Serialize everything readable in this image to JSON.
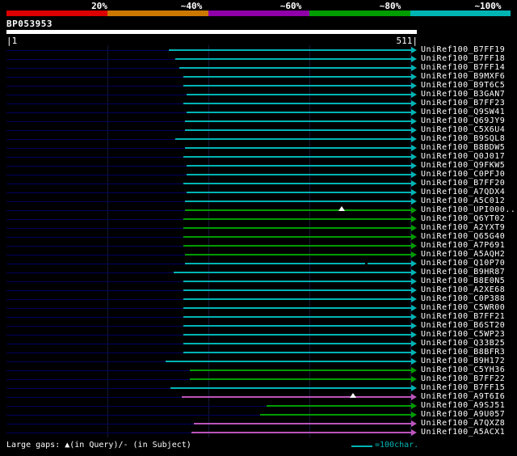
{
  "header": {
    "query_id": "BP053953",
    "coord_left": "|1",
    "coord_right": "511|",
    "scale": {
      "labels": [
        "20%",
        "~40%",
        "~60%",
        "~80%",
        "~100%"
      ],
      "colors": [
        "#dd0000",
        "#cc7700",
        "#9000a8",
        "#009c00",
        "#00b4b4"
      ]
    }
  },
  "footer": {
    "gaps_note": "Large gaps: ▲(in Query)/- (in Subject)",
    "unit_legend": "=100char.",
    "unit_legend_color": "#00b4b4"
  },
  "chart_data": {
    "type": "bar",
    "title": "BP053953",
    "xlim": [
      1,
      511
    ],
    "identity_classes": {
      "cyan": "~100%",
      "green": "~80%",
      "magenta": "~60%"
    },
    "bar_colors": {
      "cyan": "#00b4b4",
      "green": "#009c00",
      "magenta": "#bb55bb"
    },
    "rows": [
      {
        "label": "UniRef100_B7FF19",
        "start": 203,
        "end": 511,
        "identity": "cyan"
      },
      {
        "label": "UniRef100_B7FF18",
        "start": 211,
        "end": 511,
        "identity": "cyan"
      },
      {
        "label": "UniRef100_B7FF14",
        "start": 216,
        "end": 511,
        "identity": "cyan"
      },
      {
        "label": "UniRef100_B9MXF6",
        "start": 221,
        "end": 511,
        "identity": "cyan"
      },
      {
        "label": "UniRef100_B9T6C5",
        "start": 221,
        "end": 511,
        "identity": "cyan"
      },
      {
        "label": "UniRef100_B3GAN7",
        "start": 225,
        "end": 511,
        "identity": "cyan"
      },
      {
        "label": "UniRef100_B7FF23",
        "start": 221,
        "end": 511,
        "identity": "cyan"
      },
      {
        "label": "UniRef100_Q9SW41",
        "start": 225,
        "end": 511,
        "identity": "cyan"
      },
      {
        "label": "UniRef100_Q69JY9",
        "start": 223,
        "end": 511,
        "identity": "cyan"
      },
      {
        "label": "UniRef100_C5X6U4",
        "start": 223,
        "end": 511,
        "identity": "cyan"
      },
      {
        "label": "UniRef100_B9SQL8",
        "start": 211,
        "end": 511,
        "identity": "cyan"
      },
      {
        "label": "UniRef100_B8BDW5",
        "start": 223,
        "end": 511,
        "identity": "cyan"
      },
      {
        "label": "UniRef100_Q0J017",
        "start": 221,
        "end": 511,
        "identity": "cyan"
      },
      {
        "label": "UniRef100_Q9FKW5",
        "start": 225,
        "end": 511,
        "identity": "cyan"
      },
      {
        "label": "UniRef100_C0PFJ0",
        "start": 225,
        "end": 511,
        "identity": "cyan"
      },
      {
        "label": "UniRef100_B7FF20",
        "start": 221,
        "end": 511,
        "identity": "cyan"
      },
      {
        "label": "UniRef100_A7QDX4",
        "start": 225,
        "end": 511,
        "identity": "cyan"
      },
      {
        "label": "UniRef100_A5C012",
        "start": 223,
        "end": 511,
        "identity": "cyan"
      },
      {
        "label": "UniRef100_UPI000...",
        "start": 223,
        "end": 511,
        "identity": "green",
        "markers": [
          {
            "type": "query_gap",
            "pos": 418
          }
        ]
      },
      {
        "label": "UniRef100_Q6YT02",
        "start": 221,
        "end": 511,
        "identity": "green"
      },
      {
        "label": "UniRef100_A2YXT9",
        "start": 221,
        "end": 511,
        "identity": "green"
      },
      {
        "label": "UniRef100_Q65G40",
        "start": 221,
        "end": 511,
        "identity": "green"
      },
      {
        "label": "UniRef100_A7P691",
        "start": 221,
        "end": 511,
        "identity": "green"
      },
      {
        "label": "UniRef100_A5AQH2",
        "start": 223,
        "end": 511,
        "identity": "green"
      },
      {
        "label": "UniRef100_Q10P70",
        "start": 223,
        "end": 511,
        "identity": "cyan",
        "markers": [
          {
            "type": "subject_gap",
            "pos": 448
          }
        ]
      },
      {
        "label": "UniRef100_B9HR87",
        "start": 209,
        "end": 511,
        "identity": "cyan"
      },
      {
        "label": "UniRef100_B8E0N5",
        "start": 221,
        "end": 511,
        "identity": "cyan"
      },
      {
        "label": "UniRef100_A2XE68",
        "start": 221,
        "end": 511,
        "identity": "cyan"
      },
      {
        "label": "UniRef100_C0P388",
        "start": 221,
        "end": 511,
        "identity": "cyan"
      },
      {
        "label": "UniRef100_C5WR00",
        "start": 221,
        "end": 511,
        "identity": "cyan"
      },
      {
        "label": "UniRef100_B7FF21",
        "start": 221,
        "end": 511,
        "identity": "cyan"
      },
      {
        "label": "UniRef100_B6ST20",
        "start": 221,
        "end": 511,
        "identity": "cyan"
      },
      {
        "label": "UniRef100_C5WP23",
        "start": 221,
        "end": 511,
        "identity": "cyan"
      },
      {
        "label": "UniRef100_Q33B25",
        "start": 221,
        "end": 511,
        "identity": "cyan"
      },
      {
        "label": "UniRef100_B8BFR3",
        "start": 221,
        "end": 511,
        "identity": "cyan"
      },
      {
        "label": "UniRef100_B9H172",
        "start": 199,
        "end": 511,
        "identity": "cyan"
      },
      {
        "label": "UniRef100_C5YH36",
        "start": 229,
        "end": 511,
        "identity": "green"
      },
      {
        "label": "UniRef100_B7FF22",
        "start": 229,
        "end": 511,
        "identity": "green"
      },
      {
        "label": "UniRef100_B7FF15",
        "start": 205,
        "end": 511,
        "identity": "cyan"
      },
      {
        "label": "UniRef100_A9T6I6",
        "start": 219,
        "end": 511,
        "identity": "magenta",
        "markers": [
          {
            "type": "query_gap",
            "pos": 432
          }
        ]
      },
      {
        "label": "UniRef100_A9SJ51",
        "start": 324,
        "end": 511,
        "identity": "green"
      },
      {
        "label": "UniRef100_A9U057",
        "start": 316,
        "end": 511,
        "identity": "green"
      },
      {
        "label": "UniRef100_A7QXZ8",
        "start": 234,
        "end": 511,
        "identity": "magenta"
      },
      {
        "label": "UniRef100_A5ACX1",
        "start": 231,
        "end": 511,
        "identity": "magenta"
      }
    ]
  }
}
